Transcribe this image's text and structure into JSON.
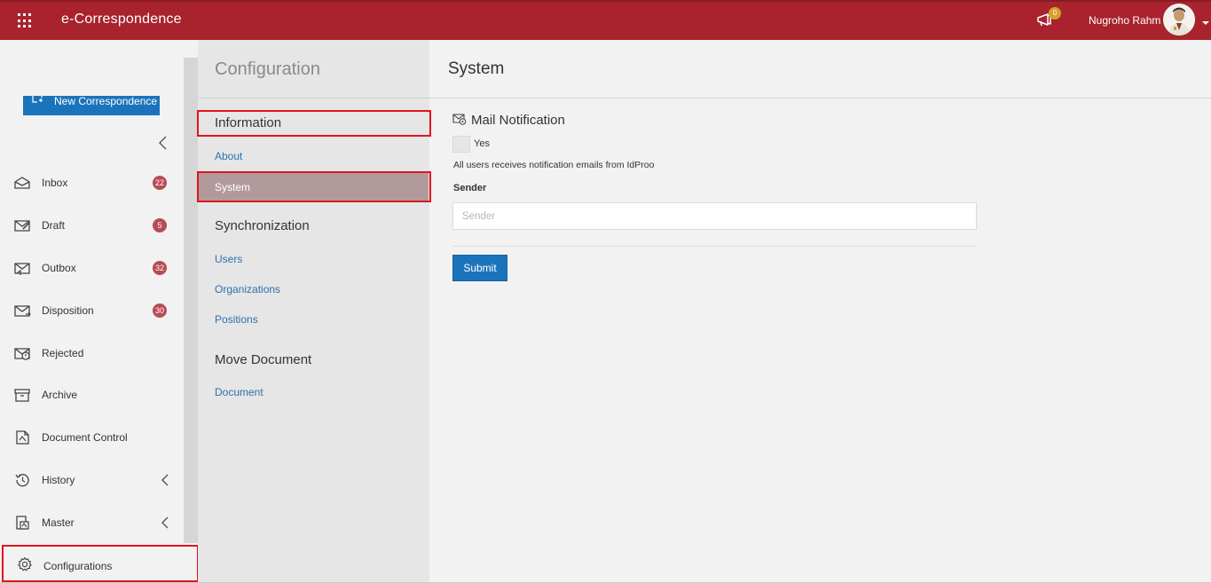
{
  "app": {
    "title": "e-Correspondence",
    "user_name": "Nugroho Rahm",
    "notification_count": "0"
  },
  "colors": {
    "topbar": "#a8232e",
    "primary_button": "#1b74bb",
    "badge": "#b94b53",
    "highlight_box": "#e0141e",
    "active_item": "#b29a9c"
  },
  "sidebar": {
    "new_button_label": "New Correspondence",
    "items": [
      {
        "label": "Inbox",
        "icon": "inbox-icon",
        "badge": "22"
      },
      {
        "label": "Draft",
        "icon": "draft-icon",
        "badge": "5"
      },
      {
        "label": "Outbox",
        "icon": "outbox-icon",
        "badge": "32"
      },
      {
        "label": "Disposition",
        "icon": "disposition-icon",
        "badge": "30"
      },
      {
        "label": "Rejected",
        "icon": "rejected-icon"
      },
      {
        "label": "Archive",
        "icon": "archive-icon"
      },
      {
        "label": "Document Control",
        "icon": "document-control-icon"
      },
      {
        "label": "History",
        "icon": "history-icon"
      },
      {
        "label": "Master",
        "icon": "master-icon"
      },
      {
        "label": "Configurations",
        "icon": "gear-icon"
      }
    ]
  },
  "config": {
    "title": "Configuration",
    "sections": [
      {
        "heading": "Information",
        "links": [
          "About",
          "System"
        ]
      },
      {
        "heading": "Synchronization",
        "links": [
          "Users",
          "Organizations",
          "Positions"
        ]
      },
      {
        "heading": "Move Document",
        "links": [
          "Document"
        ]
      }
    ],
    "active_link": "System"
  },
  "main": {
    "title": "System",
    "mail_notification": {
      "title": "Mail Notification",
      "checkbox_label": "Yes",
      "description": "All users receives notification emails from IdProo"
    },
    "sender": {
      "label": "Sender",
      "placeholder": "Sender",
      "value": ""
    },
    "submit_label": "Submit"
  }
}
